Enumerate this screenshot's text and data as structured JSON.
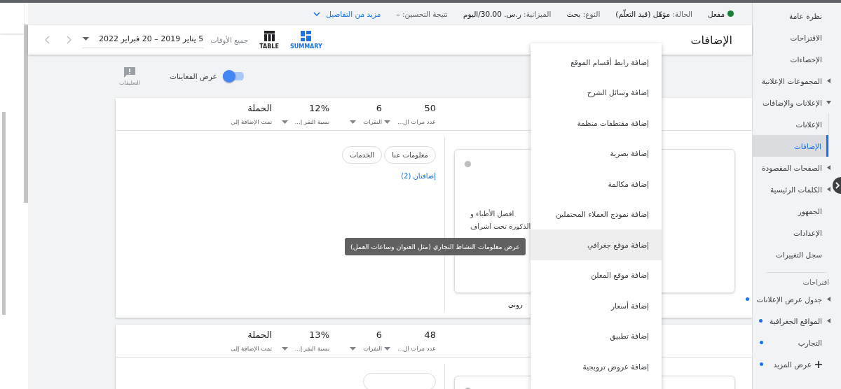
{
  "status_bar": {
    "status": "مفعل",
    "fields": [
      {
        "label": "الحالة:",
        "value": "مؤهّل (قيد التعلّم)"
      },
      {
        "label": "النوع:",
        "value": "بحث"
      },
      {
        "label": "الميزانية:",
        "value": "ر.س. 30.00/اليوم"
      },
      {
        "label": "نتيجة التحسين:",
        "value": "–"
      }
    ],
    "details_link": "مزيد من التفاصيل"
  },
  "header": {
    "title": "الإضافات",
    "views": [
      {
        "kind": "summary",
        "label": "SUMMARY",
        "selected": true
      },
      {
        "kind": "table",
        "label": "TABLE",
        "selected": false
      }
    ],
    "date_range": {
      "label": "جميع الأوقات",
      "value": "5 يناير 2019 – 20 فبراير 2022"
    }
  },
  "previews_toggle": {
    "label": "عرض المعاينات",
    "on": true
  },
  "feedback": {
    "label": "التعليقات"
  },
  "cards": [
    {
      "metrics": [
        {
          "value": "50",
          "label": "عدد مرات ال..."
        },
        {
          "value": "6",
          "label": "النقرات"
        },
        {
          "value": "12%",
          "label": "نسبة النقر إ..."
        }
      ],
      "campaign": {
        "heading": "الحملة",
        "label": "تمت الإضافة إلى"
      },
      "preview": {
        "lines": [
          "افضل الأطباء و",
          "الذكورة تحت اشراف"
        ],
        "caption": "روني"
      },
      "chips": [
        "معلومات عنا",
        "الخدمات"
      ],
      "link": "إضافتان (2)"
    },
    {
      "metrics": [
        {
          "value": "48",
          "label": "عدد مرات ال..."
        },
        {
          "value": "6",
          "label": "النقرات"
        },
        {
          "value": "13%",
          "label": "نسبة النقر إ..."
        }
      ],
      "campaign": {
        "heading": "الحملة",
        "label": "تمت الإضافة إلى"
      }
    }
  ],
  "tooltip": {
    "text": "عرض معلومات النشاط التجاري (مثل العنوان وساعات العمل)"
  },
  "menu": {
    "items": [
      {
        "label": "إضافة رابط أقسام الموقع",
        "highlighted": false
      },
      {
        "label": "إضافة وسائل الشرح",
        "highlighted": false
      },
      {
        "label": "إضافة مقتطفات منظمة",
        "highlighted": false
      },
      {
        "label": "إضافة بصرية",
        "highlighted": false
      },
      {
        "label": "إضافة مكالمة",
        "highlighted": false
      },
      {
        "label": "إضافة نموذج العملاء المحتملين",
        "highlighted": false
      },
      {
        "label": "إضافة موقع جغرافي",
        "highlighted": true
      },
      {
        "label": "إضافة موقع المعلن",
        "highlighted": false
      },
      {
        "label": "إضافة أسعار",
        "highlighted": false
      },
      {
        "label": "إضافة تطبيق",
        "highlighted": false
      },
      {
        "label": "إضافة عروض ترويجية",
        "highlighted": false
      }
    ]
  },
  "sidebar": {
    "items": [
      {
        "label": "نظرة عامة",
        "selected": false
      },
      {
        "label": "الاقتراحات",
        "selected": false
      },
      {
        "label": "الإحصاءات",
        "selected": false
      },
      {
        "label": "المجموعات الإعلانية",
        "selected": false,
        "expanded": false
      },
      {
        "label": "الإعلانات والإضافات",
        "selected": false,
        "expanded": true,
        "children": [
          {
            "label": "الإعلانات",
            "selected": false
          },
          {
            "label": "الإضافات",
            "selected": true
          }
        ]
      },
      {
        "label": "الصفحات المقصودة",
        "selected": false,
        "expanded": false
      },
      {
        "label": "الكلمات الرئيسية",
        "selected": false,
        "expanded": false
      },
      {
        "label": "الجمهور",
        "selected": false
      },
      {
        "label": "الإعدادات",
        "selected": false
      },
      {
        "label": "سجل التغييرات",
        "selected": false
      }
    ],
    "section_title": "اقتراحات",
    "suggestions": [
      {
        "kind": "link",
        "label": "جدول عرض الإعلانات",
        "expanded": false,
        "new": true
      },
      {
        "kind": "link",
        "label": "المواقع الجغرافية",
        "expanded": false,
        "new": true
      },
      {
        "kind": "link",
        "label": "التجارب",
        "new": true
      },
      {
        "kind": "more",
        "label": "عرض المزيد",
        "new": true
      }
    ]
  }
}
